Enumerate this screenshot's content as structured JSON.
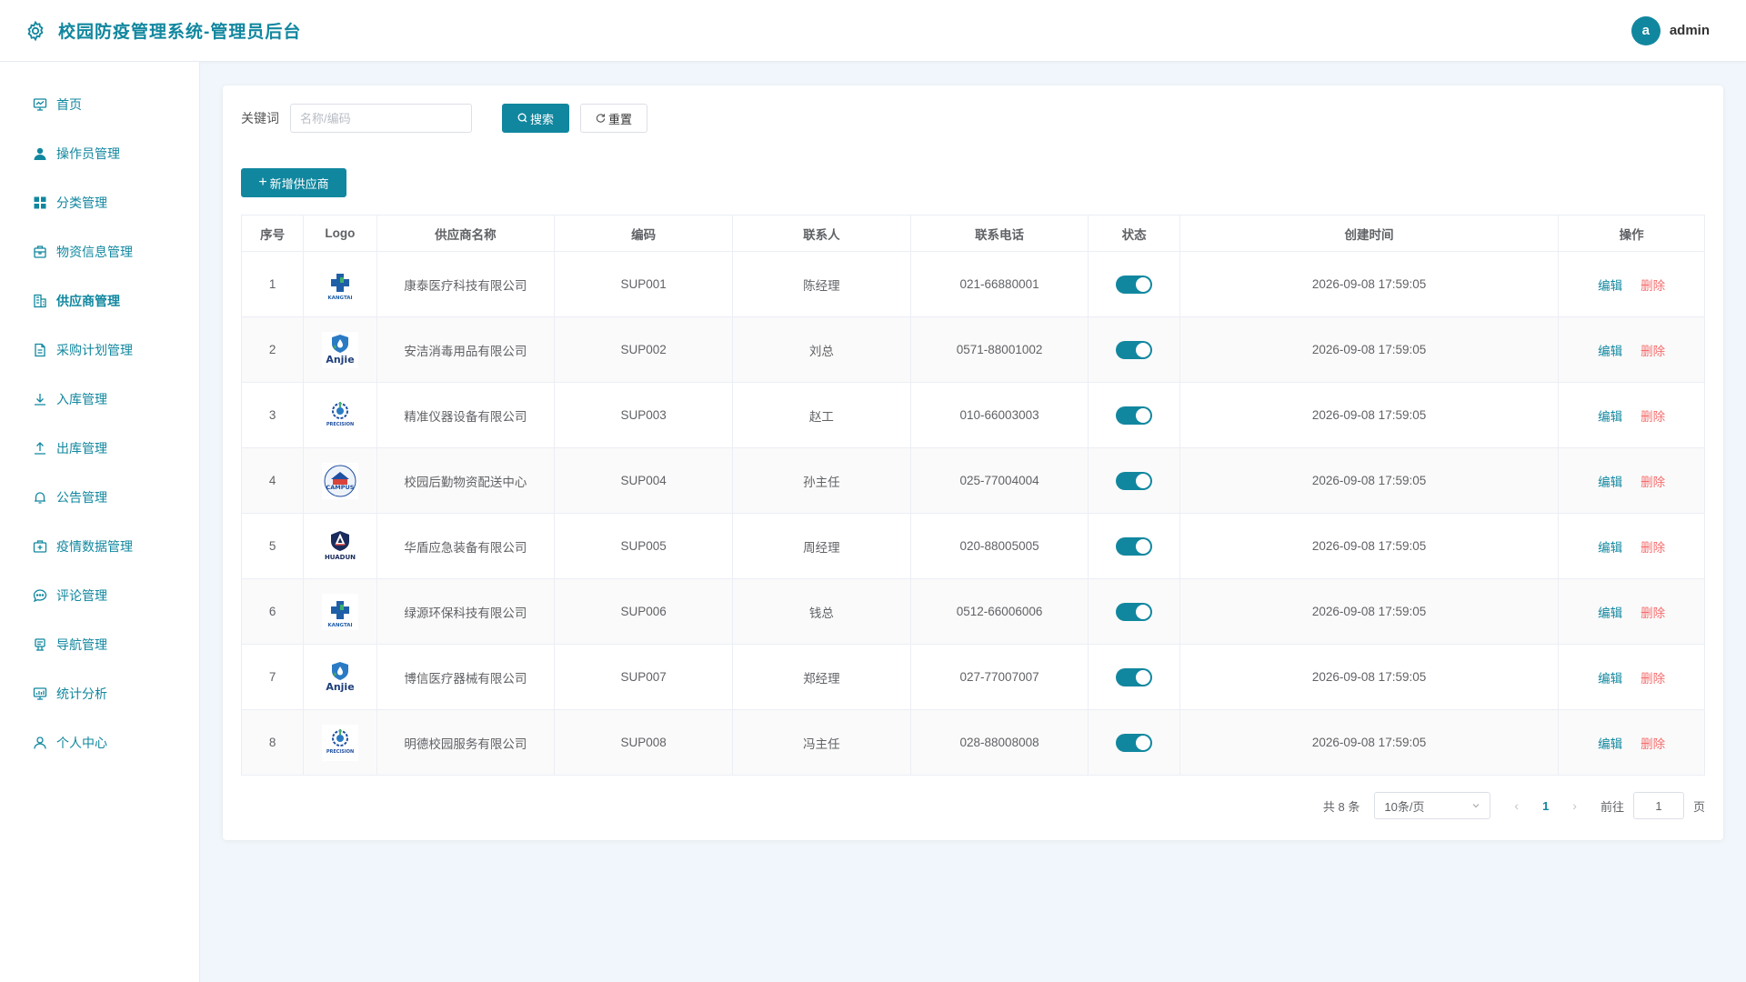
{
  "app": {
    "title": "校园防疫管理系统-管理员后台"
  },
  "user": {
    "avatar_letter": "a",
    "name": "admin"
  },
  "sidebar": {
    "items": [
      {
        "label": "首页",
        "icon": "dashboard-icon"
      },
      {
        "label": "操作员管理",
        "icon": "user-icon"
      },
      {
        "label": "分类管理",
        "icon": "grid-icon"
      },
      {
        "label": "物资信息管理",
        "icon": "box-icon"
      },
      {
        "label": "供应商管理",
        "icon": "building-icon"
      },
      {
        "label": "采购计划管理",
        "icon": "document-icon"
      },
      {
        "label": "入库管理",
        "icon": "download-icon"
      },
      {
        "label": "出库管理",
        "icon": "upload-icon"
      },
      {
        "label": "公告管理",
        "icon": "bell-icon"
      },
      {
        "label": "疫情数据管理",
        "icon": "medical-box-icon"
      },
      {
        "label": "评论管理",
        "icon": "chat-icon"
      },
      {
        "label": "导航管理",
        "icon": "guide-icon"
      },
      {
        "label": "统计分析",
        "icon": "chart-icon"
      },
      {
        "label": "个人中心",
        "icon": "person-icon"
      }
    ],
    "active_index": 4
  },
  "search": {
    "label": "关键词",
    "placeholder": "名称/编码",
    "value": "",
    "search_button": "搜索",
    "reset_button": "重置"
  },
  "toolbar": {
    "add_button": "新增供应商"
  },
  "table": {
    "columns": [
      "序号",
      "Logo",
      "供应商名称",
      "编码",
      "联系人",
      "联系电话",
      "状态",
      "创建时间",
      "操作"
    ],
    "rows": [
      {
        "index": "1",
        "logo": "KANGTAI",
        "name": "康泰医疗科技有限公司",
        "code": "SUP001",
        "contact": "陈经理",
        "phone": "021-66880001",
        "enabled": true,
        "created": "2026-09-08 17:59:05"
      },
      {
        "index": "2",
        "logo": "Anjie",
        "name": "安洁消毒用品有限公司",
        "code": "SUP002",
        "contact": "刘总",
        "phone": "0571-88001002",
        "enabled": true,
        "created": "2026-09-08 17:59:05"
      },
      {
        "index": "3",
        "logo": "PRECISION",
        "name": "精准仪器设备有限公司",
        "code": "SUP003",
        "contact": "赵工",
        "phone": "010-66003003",
        "enabled": true,
        "created": "2026-09-08 17:59:05"
      },
      {
        "index": "4",
        "logo": "CAMPUS",
        "name": "校园后勤物资配送中心",
        "code": "SUP004",
        "contact": "孙主任",
        "phone": "025-77004004",
        "enabled": true,
        "created": "2026-09-08 17:59:05"
      },
      {
        "index": "5",
        "logo": "HUADUN",
        "name": "华盾应急装备有限公司",
        "code": "SUP005",
        "contact": "周经理",
        "phone": "020-88005005",
        "enabled": true,
        "created": "2026-09-08 17:59:05"
      },
      {
        "index": "6",
        "logo": "KANGTAI",
        "name": "绿源环保科技有限公司",
        "code": "SUP006",
        "contact": "钱总",
        "phone": "0512-66006006",
        "enabled": true,
        "created": "2026-09-08 17:59:05"
      },
      {
        "index": "7",
        "logo": "Anjie",
        "name": "博信医疗器械有限公司",
        "code": "SUP007",
        "contact": "郑经理",
        "phone": "027-77007007",
        "enabled": true,
        "created": "2026-09-08 17:59:05"
      },
      {
        "index": "8",
        "logo": "PRECISION",
        "name": "明德校园服务有限公司",
        "code": "SUP008",
        "contact": "冯主任",
        "phone": "028-88008008",
        "enabled": true,
        "created": "2026-09-08 17:59:05"
      }
    ],
    "actions": {
      "edit": "编辑",
      "delete": "删除"
    }
  },
  "pagination": {
    "total_text": "共 8 条",
    "page_size": "10条/页",
    "current_page": "1",
    "goto_label": "前往",
    "goto_value": "1",
    "page_unit": "页"
  },
  "colors": {
    "accent": "#11879f",
    "danger": "#f56c6c",
    "background": "#f0f6fb"
  }
}
